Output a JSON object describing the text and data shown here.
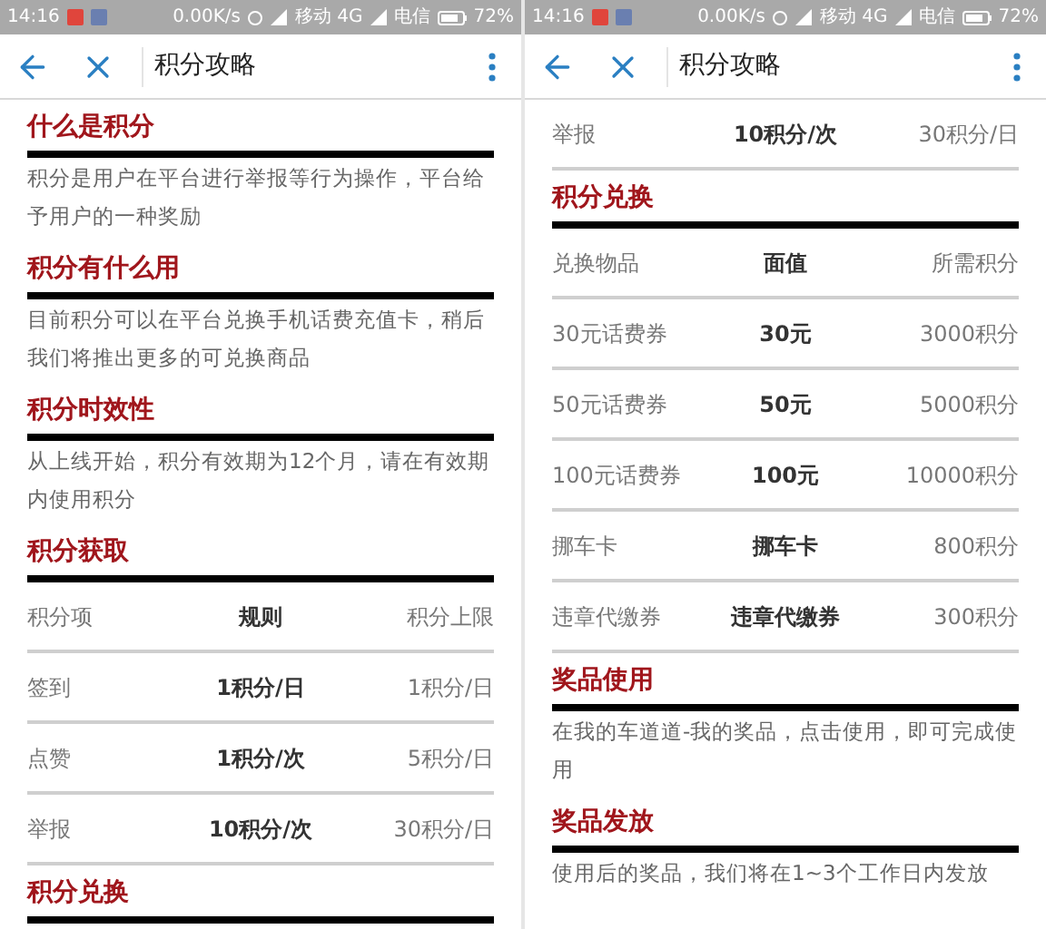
{
  "screens": [
    {
      "status_bar": {
        "time": "14:16",
        "speed": "0.00K/s",
        "carrier_1": "移动 4G",
        "carrier_2": "电信",
        "battery": "72%"
      },
      "toolbar": {
        "title": "积分攻略"
      },
      "blocks": [
        {
          "kind": "heading",
          "text": "什么是积分"
        },
        {
          "kind": "paragraph",
          "text": "积分是用户在平台进行举报等行为操作，平台给予用户的一种奖励"
        },
        {
          "kind": "heading",
          "text": "积分有什么用"
        },
        {
          "kind": "paragraph",
          "text": "目前积分可以在平台兑换手机话费充值卡，稍后我们将推出更多的可兑换商品"
        },
        {
          "kind": "heading",
          "text": "积分时效性"
        },
        {
          "kind": "paragraph",
          "text": "从上线开始，积分有效期为12个月，请在有效期内使用积分"
        },
        {
          "kind": "heading",
          "text": "积分获取"
        },
        {
          "kind": "table",
          "columns": [
            "积分项",
            "规则",
            "积分上限"
          ],
          "rows": [
            [
              "签到",
              "1积分/日",
              "1积分/日"
            ],
            [
              "点赞",
              "1积分/次",
              "5积分/日"
            ],
            [
              "举报",
              "10积分/次",
              "30积分/日"
            ]
          ]
        },
        {
          "kind": "heading",
          "text": "积分兑换"
        }
      ]
    },
    {
      "status_bar": {
        "time": "14:16",
        "speed": "0.00K/s",
        "carrier_1": "移动 4G",
        "carrier_2": "电信",
        "battery": "72%"
      },
      "toolbar": {
        "title": "积分攻略"
      },
      "blocks": [
        {
          "kind": "table",
          "rows": [
            [
              "举报",
              "10积分/次",
              "30积分/日"
            ]
          ]
        },
        {
          "kind": "heading",
          "text": "积分兑换"
        },
        {
          "kind": "table",
          "columns": [
            "兑换物品",
            "面值",
            "所需积分"
          ],
          "rows": [
            [
              "30元话费券",
              "30元",
              "3000积分"
            ],
            [
              "50元话费券",
              "50元",
              "5000积分"
            ],
            [
              "100元话费券",
              "100元",
              "10000积分"
            ],
            [
              "挪车卡",
              "挪车卡",
              "800积分"
            ],
            [
              "违章代缴券",
              "违章代缴券",
              "300积分"
            ]
          ]
        },
        {
          "kind": "heading",
          "text": "奖品使用"
        },
        {
          "kind": "paragraph",
          "text": "在我的车道道-我的奖品，点击使用，即可完成使用"
        },
        {
          "kind": "heading",
          "text": "奖品发放"
        },
        {
          "kind": "paragraph",
          "text": "使用后的奖品，我们将在1~3个工作日内发放"
        }
      ]
    }
  ]
}
